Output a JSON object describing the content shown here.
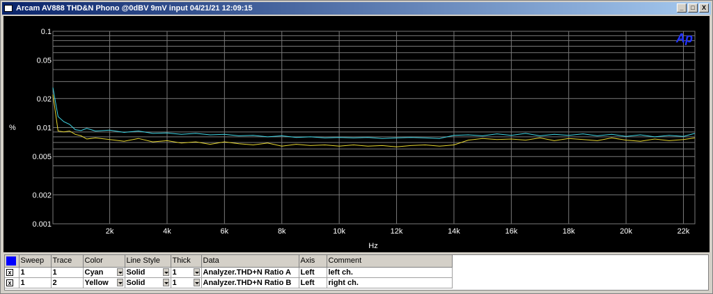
{
  "window": {
    "title": "Arcam AV888 THD&N Phono @0dBV 9mV input  04/21/21 12:09:15",
    "minimize": "_",
    "maximize": "□",
    "close": "X"
  },
  "logo": {
    "text": "Ap",
    "color": "#2233ff"
  },
  "colors": {
    "background": "#000000",
    "grid": "#7a7a7a",
    "axis_text": "#ffffff",
    "cyan": "#40d8e8",
    "yellow": "#e8d830"
  },
  "chart_data": {
    "type": "line",
    "title": "",
    "xlabel": "Hz",
    "ylabel": "%",
    "xlim": [
      20,
      22400
    ],
    "ylim": [
      0.001,
      0.1
    ],
    "yscale": "log",
    "grid": true,
    "x_ticks": [
      {
        "value": 2000,
        "label": "2k"
      },
      {
        "value": 4000,
        "label": "4k"
      },
      {
        "value": 6000,
        "label": "6k"
      },
      {
        "value": 8000,
        "label": "8k"
      },
      {
        "value": 10000,
        "label": "10k"
      },
      {
        "value": 12000,
        "label": "12k"
      },
      {
        "value": 14000,
        "label": "14k"
      },
      {
        "value": 16000,
        "label": "16k"
      },
      {
        "value": 18000,
        "label": "18k"
      },
      {
        "value": 20000,
        "label": "20k"
      },
      {
        "value": 22000,
        "label": "22k"
      }
    ],
    "y_ticks": [
      {
        "value": 0.1,
        "label": "0.1"
      },
      {
        "value": 0.05,
        "label": "0.05"
      },
      {
        "value": 0.02,
        "label": "0.02"
      },
      {
        "value": 0.01,
        "label": "0.01"
      },
      {
        "value": 0.005,
        "label": "0.005"
      },
      {
        "value": 0.002,
        "label": "0.002"
      },
      {
        "value": 0.001,
        "label": "0.001"
      }
    ],
    "series": [
      {
        "name": "Cyan",
        "color": "#40d8e8",
        "x": [
          20,
          200,
          400,
          600,
          800,
          1000,
          1200,
          1500,
          2000,
          2500,
          3000,
          3500,
          4000,
          4500,
          5000,
          5500,
          6000,
          6500,
          7000,
          7500,
          8000,
          8500,
          9000,
          9500,
          10000,
          10500,
          11000,
          11500,
          12000,
          12500,
          13000,
          13500,
          14000,
          14500,
          15000,
          15500,
          16000,
          16500,
          17000,
          17500,
          18000,
          18500,
          19000,
          19500,
          20000,
          20500,
          21000,
          21500,
          22000,
          22400
        ],
        "y": [
          0.026,
          0.013,
          0.0115,
          0.0108,
          0.0095,
          0.0093,
          0.0098,
          0.0092,
          0.0094,
          0.0089,
          0.0092,
          0.0087,
          0.0088,
          0.0085,
          0.0087,
          0.0084,
          0.0085,
          0.0082,
          0.0083,
          0.008,
          0.0082,
          0.0079,
          0.008,
          0.0078,
          0.0079,
          0.0078,
          0.0079,
          0.0077,
          0.0078,
          0.0079,
          0.0078,
          0.0077,
          0.0083,
          0.0084,
          0.0082,
          0.0086,
          0.0083,
          0.0087,
          0.0082,
          0.0085,
          0.0083,
          0.0086,
          0.0082,
          0.0085,
          0.0081,
          0.0084,
          0.008,
          0.0083,
          0.0081,
          0.0087
        ]
      },
      {
        "name": "Yellow",
        "color": "#e8d830",
        "x": [
          20,
          200,
          400,
          600,
          800,
          1000,
          1200,
          1500,
          2000,
          2500,
          3000,
          3500,
          4000,
          4500,
          5000,
          5500,
          6000,
          6500,
          7000,
          7500,
          8000,
          8500,
          9000,
          9500,
          10000,
          10500,
          11000,
          11500,
          12000,
          12500,
          13000,
          13500,
          14000,
          14500,
          15000,
          15500,
          16000,
          16500,
          17000,
          17500,
          18000,
          18500,
          19000,
          19500,
          20000,
          20500,
          21000,
          21500,
          22000,
          22400
        ],
        "y": [
          0.022,
          0.0092,
          0.009,
          0.0092,
          0.0085,
          0.0082,
          0.0076,
          0.0078,
          0.0075,
          0.0072,
          0.0077,
          0.0071,
          0.0073,
          0.0069,
          0.0071,
          0.0067,
          0.0071,
          0.0068,
          0.0066,
          0.0069,
          0.0064,
          0.0067,
          0.0065,
          0.0066,
          0.0064,
          0.0066,
          0.0064,
          0.0065,
          0.0063,
          0.0065,
          0.0066,
          0.0064,
          0.0066,
          0.0074,
          0.0077,
          0.0075,
          0.0076,
          0.0074,
          0.0078,
          0.0073,
          0.0077,
          0.0075,
          0.0073,
          0.0078,
          0.0074,
          0.0072,
          0.0076,
          0.0073,
          0.0075,
          0.0078
        ]
      }
    ]
  },
  "legend": {
    "headers": [
      "Sweep",
      "Trace",
      "Color",
      "Line Style",
      "Thick",
      "Data",
      "Axis",
      "Comment"
    ],
    "rows": [
      {
        "checked": "x",
        "sweep": "1",
        "trace": "1",
        "color": "Cyan",
        "line_style": "Solid",
        "thick": "1",
        "data": "Analyzer.THD+N Ratio A",
        "axis": "Left",
        "comment": "left ch."
      },
      {
        "checked": "x",
        "sweep": "1",
        "trace": "2",
        "color": "Yellow",
        "line_style": "Solid",
        "thick": "1",
        "data": "Analyzer.THD+N Ratio B",
        "axis": "Left",
        "comment": "right ch."
      }
    ]
  }
}
